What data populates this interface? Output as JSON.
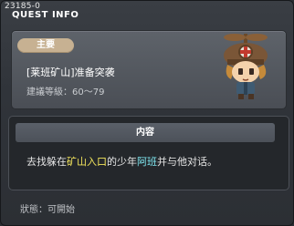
{
  "window": {
    "quest_id": "23185-0",
    "title": "QUEST INFO"
  },
  "summary": {
    "tag": "主要",
    "quest_name": "[莱班矿山]准备突袭",
    "level_range": "建議等級：60～79",
    "npc_icon": "npc-portrait-icon"
  },
  "content": {
    "section_title": "内容",
    "description_parts": {
      "p1": "去找躲在",
      "location": "矿山入口",
      "p2": "的少年",
      "npc_name": "阿班",
      "p3": "并与他对话。"
    }
  },
  "footer": {
    "status": "狀態：可開始"
  },
  "colors": {
    "location_highlight": "#f2e45c",
    "npc_highlight": "#7fe7f0",
    "tag_bg": "#c7b192"
  }
}
